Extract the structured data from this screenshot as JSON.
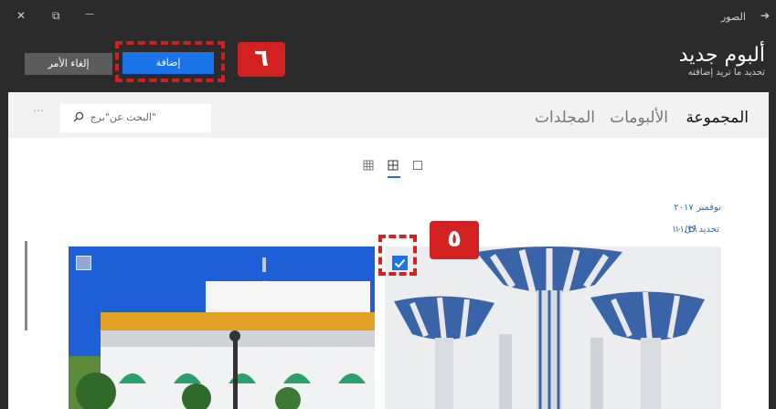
{
  "window": {
    "app_name": "الصور",
    "close_glyph": "✕",
    "restore_glyph": "⧉",
    "minimize_glyph": "—",
    "back_glyph": "➔"
  },
  "header": {
    "title": "ألبوم جديد",
    "subtitle": "تحديد ما تريد إضافته",
    "add_label": "إضافة",
    "cancel_label": "إلغاء الأمر"
  },
  "nav": {
    "tabs": [
      "المجموعة",
      "الألبومات",
      "المجلدات"
    ],
    "active_index": 0,
    "search_placeholder": "البحث عن\"برج\"",
    "more_glyph": "⋯"
  },
  "gallery": {
    "month": "نوفمبر ٢٠١٧",
    "day": "١١/٢٨",
    "select_all": "تحديد كل ١٠"
  },
  "annotations": {
    "badge_add": "٦",
    "badge_check": "٥"
  },
  "colors": {
    "accent": "#1a73e8",
    "annotation_red": "#d32020",
    "titlebar": "#2b2b2b"
  }
}
